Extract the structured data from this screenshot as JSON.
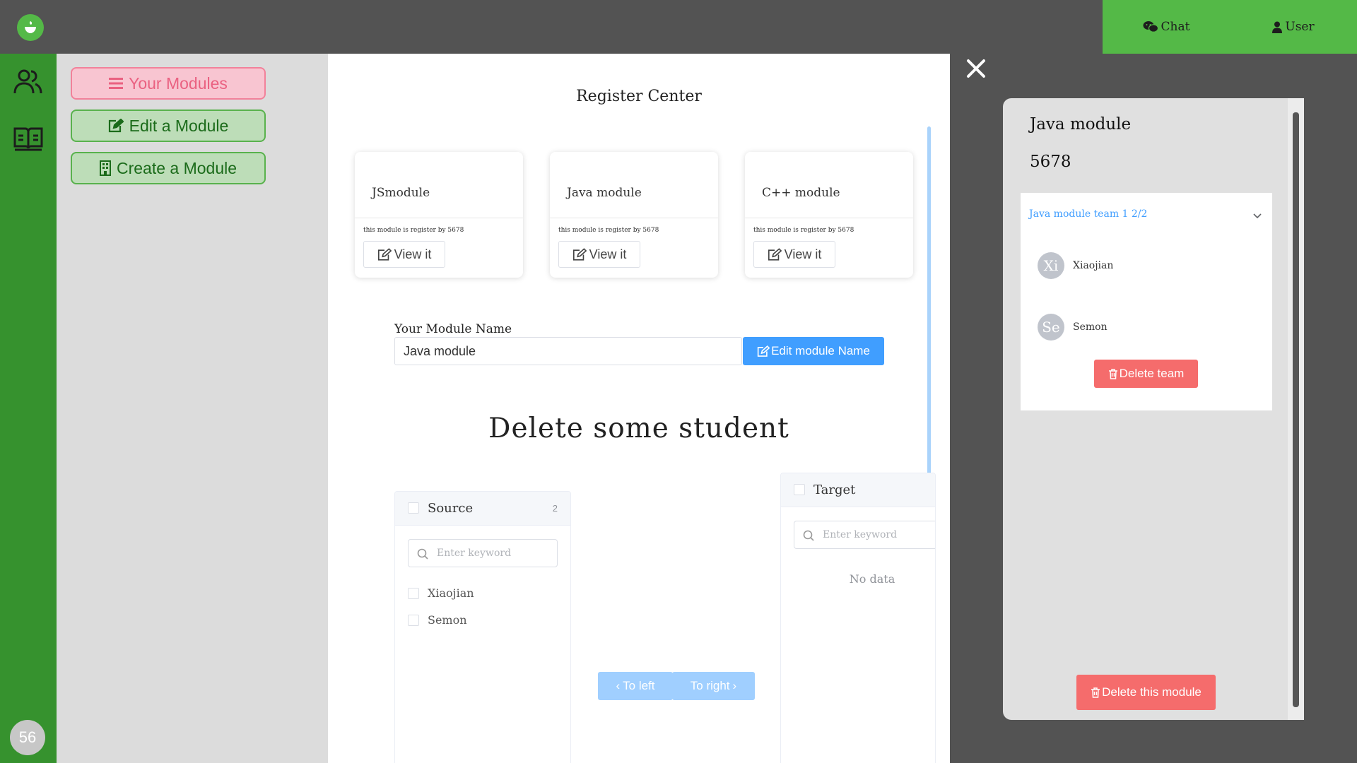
{
  "topbar": {
    "logo_icon": "leaf-cup-logo-icon",
    "chat_label": "Chat",
    "user_label": "User"
  },
  "rail": {
    "icons": [
      "users-icon",
      "book-icon"
    ],
    "badge_value": "56"
  },
  "menu": {
    "your_modules": "Your Modules",
    "edit_module": "Edit a Module",
    "create_module": "Create a Module"
  },
  "main": {
    "title": "Register Center",
    "cards": [
      {
        "name": "JSmodule",
        "desc": "this module is register by 5678",
        "button": "View it"
      },
      {
        "name": "Java module",
        "desc": "this module is register by 5678",
        "button": "View it"
      },
      {
        "name": "C++ module",
        "desc": "this module is register by 5678",
        "button": "View it"
      }
    ],
    "name_label": "Your Module Name",
    "name_value": "Java module",
    "edit_name_button": "Edit module Name",
    "delete_title": "Delete some student",
    "transfer": {
      "source_title": "Source",
      "source_count": "2",
      "target_title": "Target",
      "search_placeholder": "Enter keyword",
      "source_items": [
        "Xiaojian",
        "Semon"
      ],
      "no_data": "No data",
      "to_left": "To left",
      "to_right": "To right"
    }
  },
  "drawer": {
    "module_name": "Java module",
    "module_code": "5678",
    "team_header": "Java module team 1  2/2",
    "members": [
      {
        "initials": "Xi",
        "name": "Xiaojian"
      },
      {
        "initials": "Se",
        "name": "Semon"
      }
    ],
    "delete_team": "Delete team",
    "delete_module": "Delete this module"
  },
  "colors": {
    "brand_green": "#54b947",
    "rail_green": "#36922e",
    "primary_blue": "#409eff",
    "danger_red": "#f56c6c",
    "pink": "#f8c5d1"
  }
}
